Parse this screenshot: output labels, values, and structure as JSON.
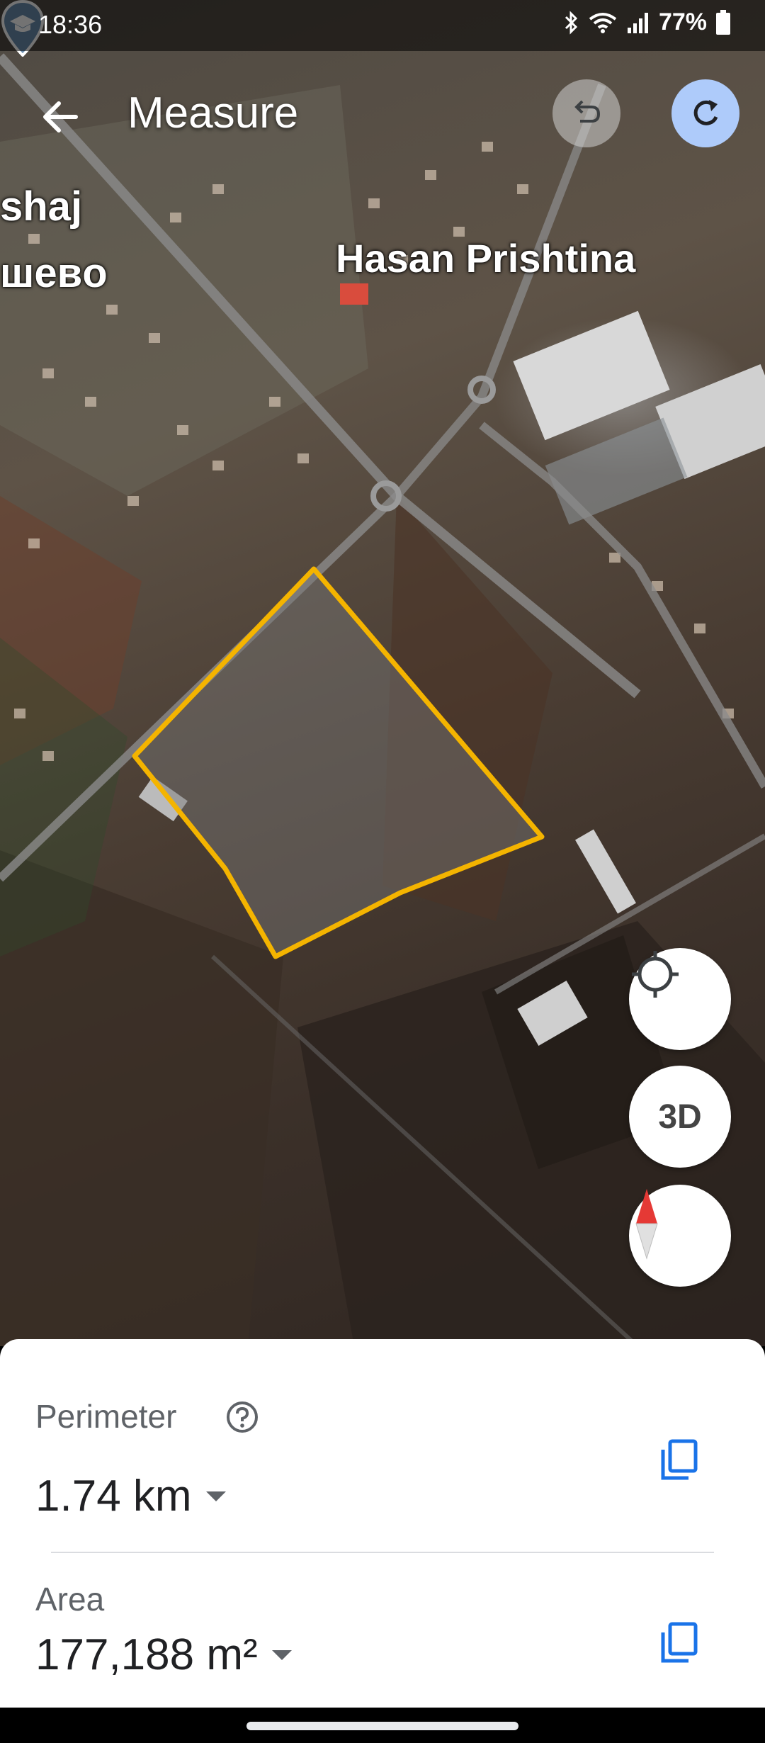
{
  "status_bar": {
    "time": "18:36",
    "battery_percent": "77%",
    "icons": [
      "bluetooth-icon",
      "wifi-icon",
      "signal-icon",
      "battery-icon"
    ]
  },
  "app_bar": {
    "title": "Measure",
    "back_icon": "arrow-back-icon",
    "undo_icon": "undo-icon",
    "redo_icon": "redo-icon"
  },
  "map": {
    "labels": {
      "place_line1": "shaj",
      "place_line2": "шевo",
      "poi_name": "Hasan Prishtina"
    },
    "poi_icon": "school-pin-icon",
    "polygon_color": "#f4b400"
  },
  "map_controls": {
    "location_icon": "my-location-icon",
    "view_3d_label": "3D",
    "compass_icon": "compass-icon"
  },
  "measurements": {
    "perimeter_label": "Perimeter",
    "perimeter_value": "1.74 km",
    "area_label": "Area",
    "area_value": "177,188 m²",
    "help_icon": "help-icon",
    "copy_icon": "copy-icon"
  },
  "colors": {
    "accent_blue": "#1a73e8",
    "redo_bg": "#aecbfa",
    "polygon_outline": "#f4b400"
  }
}
